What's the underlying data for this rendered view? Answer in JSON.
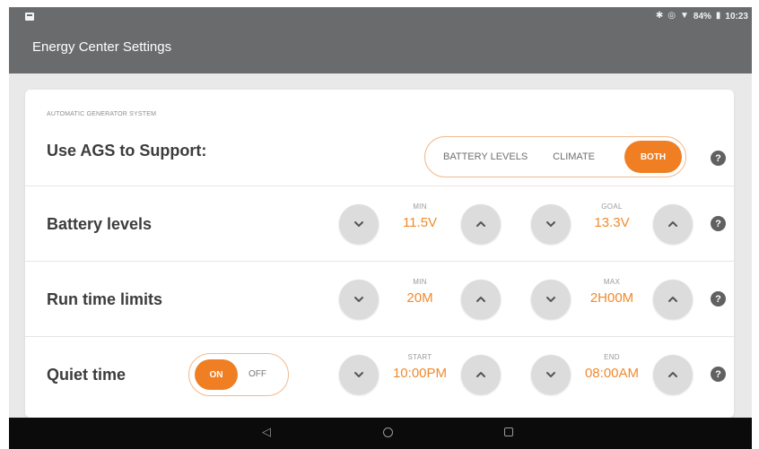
{
  "status_bar": {
    "battery": "84%",
    "time": "10:23",
    "icons": [
      "bluetooth-icon",
      "target-icon",
      "wifi-icon",
      "battery-icon"
    ]
  },
  "app": {
    "title": "Energy Center Settings"
  },
  "ags": {
    "caption": "AUTOMATIC GENERATOR SYSTEM",
    "label": "Use AGS to Support:",
    "options": [
      "BATTERY LEVELS",
      "CLIMATE",
      "BOTH"
    ],
    "selected": "BOTH"
  },
  "battery_levels": {
    "label": "Battery levels",
    "left": {
      "caption": "MIN",
      "value": "11.5V"
    },
    "right": {
      "caption": "GOAL",
      "value": "13.3V"
    }
  },
  "run_time_limits": {
    "label": "Run time limits",
    "left": {
      "caption": "MIN",
      "value": "20M"
    },
    "right": {
      "caption": "MAX",
      "value": "2H00M"
    }
  },
  "quiet_time": {
    "label": "Quiet time",
    "toggle": {
      "on": "ON",
      "off": "OFF",
      "state": "ON"
    },
    "left": {
      "caption": "START",
      "value": "10:00PM"
    },
    "right": {
      "caption": "END",
      "value": "08:00AM"
    }
  },
  "help_symbol": "?",
  "nav": {
    "back": "◁"
  },
  "colors": {
    "accent": "#f07f24",
    "app_bar": "#6a6b6d",
    "value_text": "#f08a2e"
  }
}
